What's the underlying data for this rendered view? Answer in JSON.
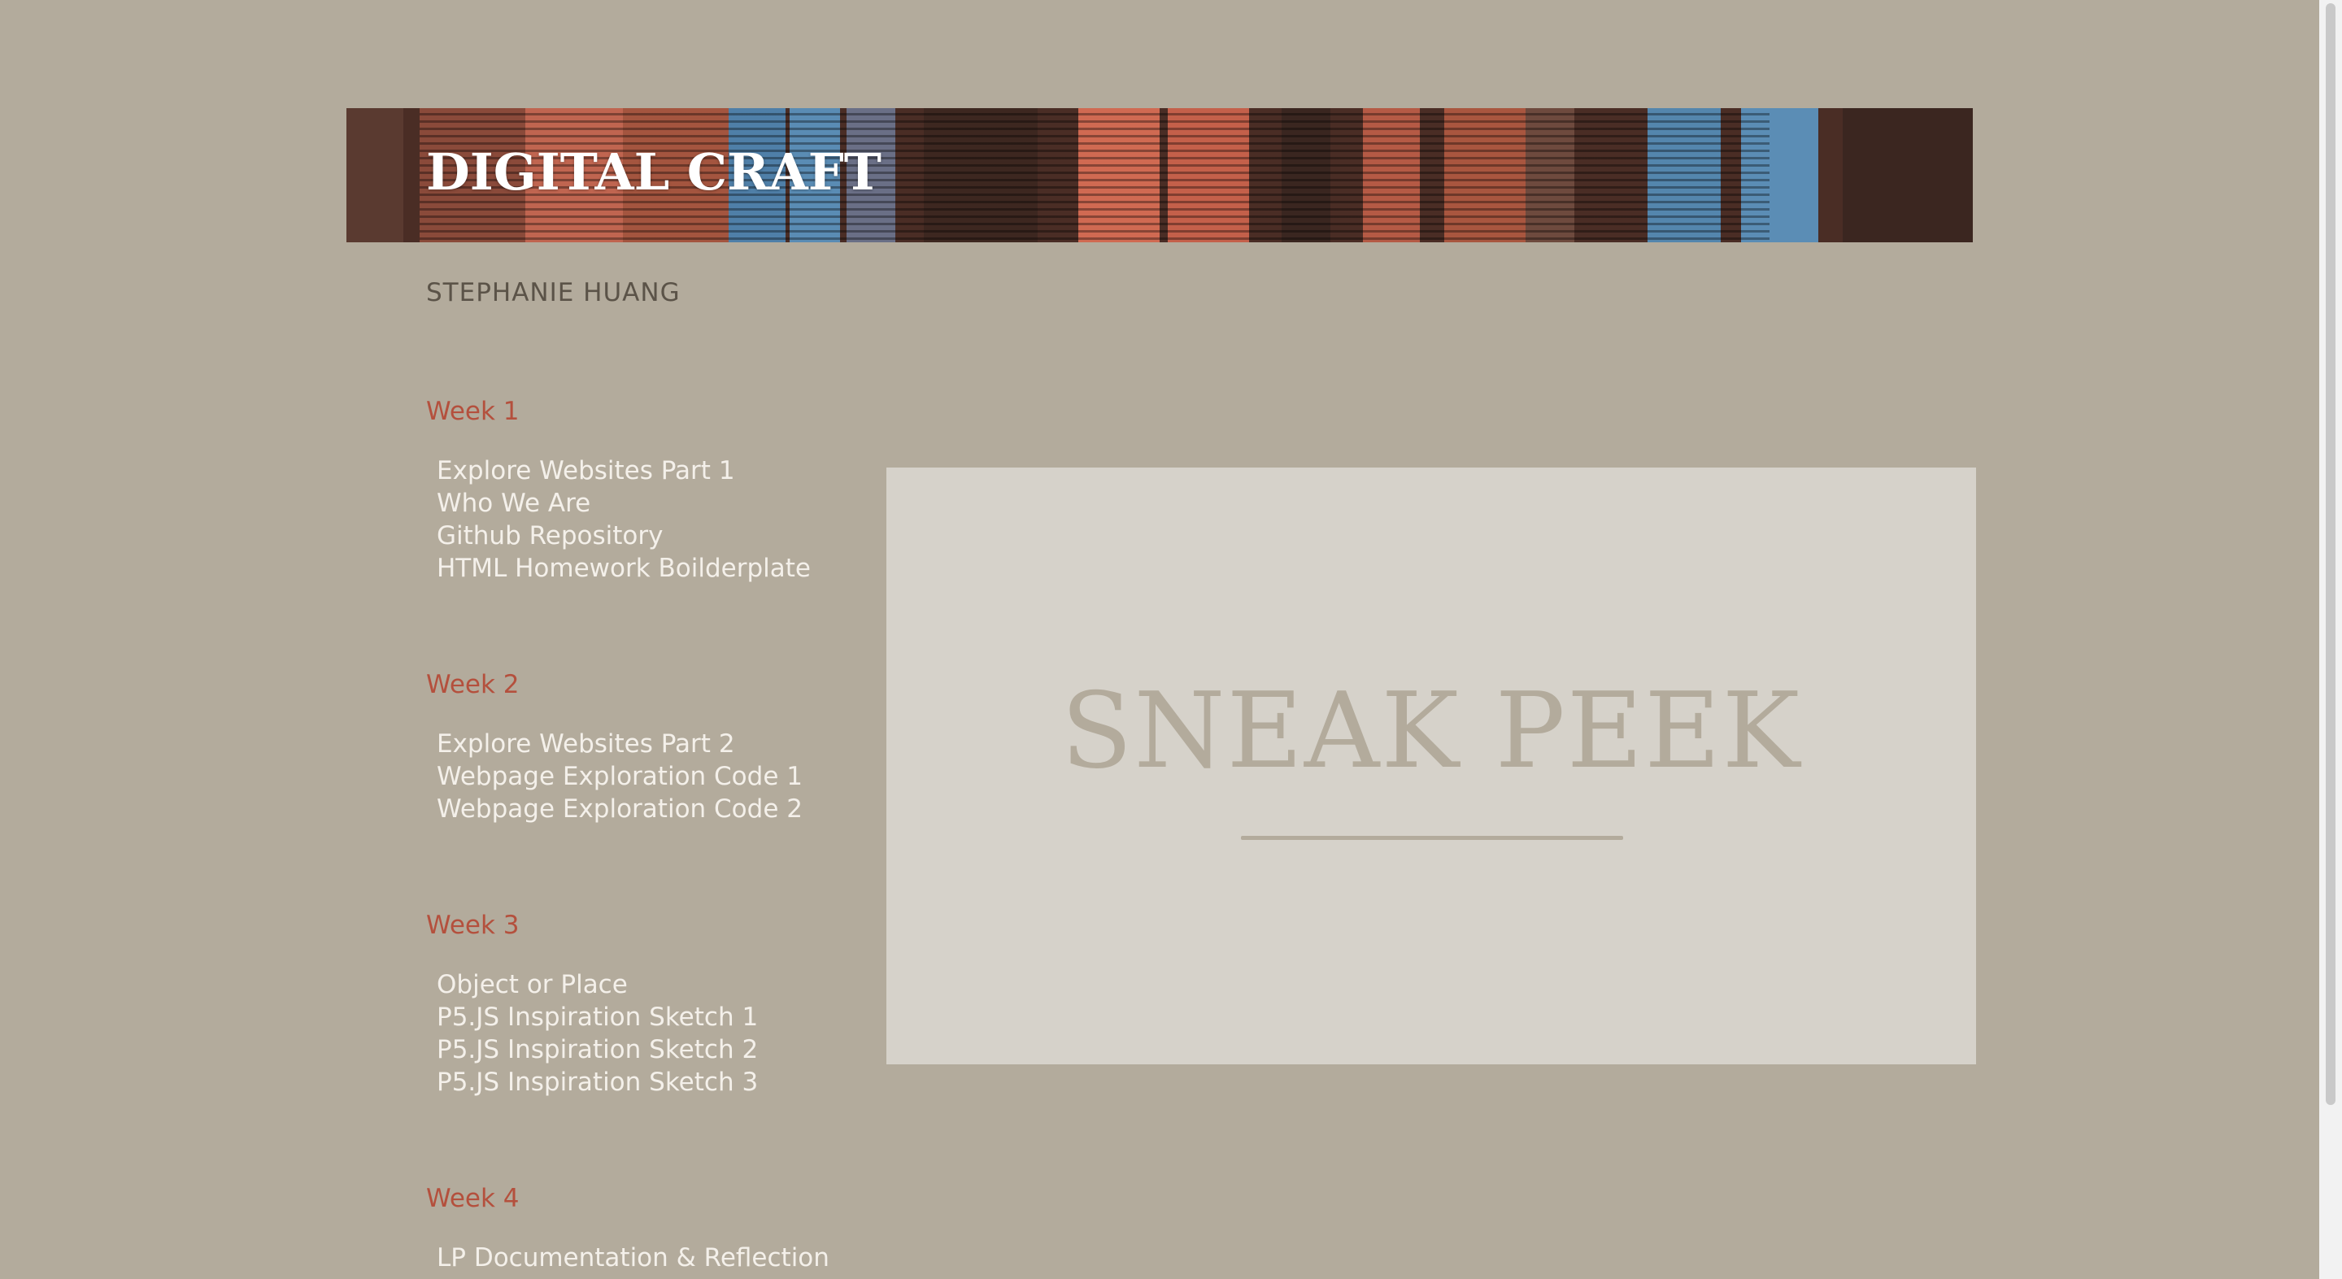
{
  "header": {
    "title": "DIGITAL CRAFT",
    "author": "STEPHANIE HUANG"
  },
  "weeks": [
    {
      "heading": "Week 1",
      "links": [
        "Explore Websites Part 1",
        "Who We Are",
        "Github Repository",
        "HTML Homework Boilderplate"
      ]
    },
    {
      "heading": "Week 2",
      "links": [
        "Explore Websites Part 2",
        "Webpage Exploration Code 1",
        "Webpage Exploration Code 2"
      ]
    },
    {
      "heading": "Week 3",
      "links": [
        "Object or Place",
        "P5.JS Inspiration Sketch 1",
        "P5.JS Inspiration Sketch 2",
        "P5.JS Inspiration Sketch 3"
      ]
    },
    {
      "heading": "Week 4",
      "links": [
        "LP Documentation & Reflection"
      ]
    }
  ],
  "preview": {
    "title": "SNEAK PEEK"
  },
  "colors": {
    "background": "#b3ab9c",
    "week_heading": "#b4503d",
    "link_text": "#f4f0ea",
    "preview_panel": "#d6d2ca"
  }
}
